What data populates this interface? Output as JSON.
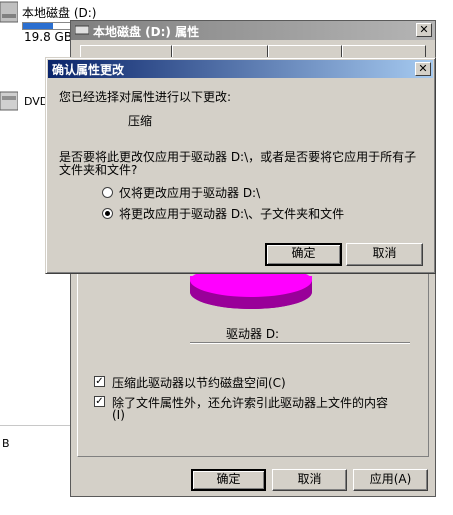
{
  "background": {
    "drive_label": "本地磁盘 (D:)",
    "drive_size": "19.8 GB",
    "dvd_label": "DVD",
    "dvd_icon": "dvd-drive-icon",
    "disk_icon": "hard-disk-icon",
    "partial_text": "B"
  },
  "properties_window": {
    "title": "本地磁盘 (D:) 属性",
    "title_icon": "hard-disk-icon",
    "close_glyph": "✕",
    "drive_caption": "驱动器 D:",
    "checkbox_compress": {
      "label": "压缩此驱动器以节约磁盘空间(C)",
      "checked": true
    },
    "checkbox_index": {
      "label_line1": "除了文件属性外，还允许索引此驱动器上文件的内容",
      "label_line2": "(I)",
      "checked": true
    },
    "buttons": {
      "ok": "确定",
      "cancel": "取消",
      "apply": "应用(A)"
    },
    "pie_colors": {
      "used": "#ff00ff",
      "shadow": "#990099"
    }
  },
  "confirm_dialog": {
    "title": "确认属性更改",
    "close_glyph": "✕",
    "intro": "您已经选择对属性进行以下更改:",
    "change": "压缩",
    "question_line1": "是否要将此更改仅应用于驱动器 D:\\，或者是否要将它应用于所有子",
    "question_line2": "文件夹和文件?",
    "options": [
      {
        "label": "仅将更改应用于驱动器 D:\\",
        "selected": false
      },
      {
        "label": "将更改应用于驱动器 D:\\、子文件夹和文件",
        "selected": true
      }
    ],
    "buttons": {
      "ok": "确定",
      "cancel": "取消"
    }
  }
}
